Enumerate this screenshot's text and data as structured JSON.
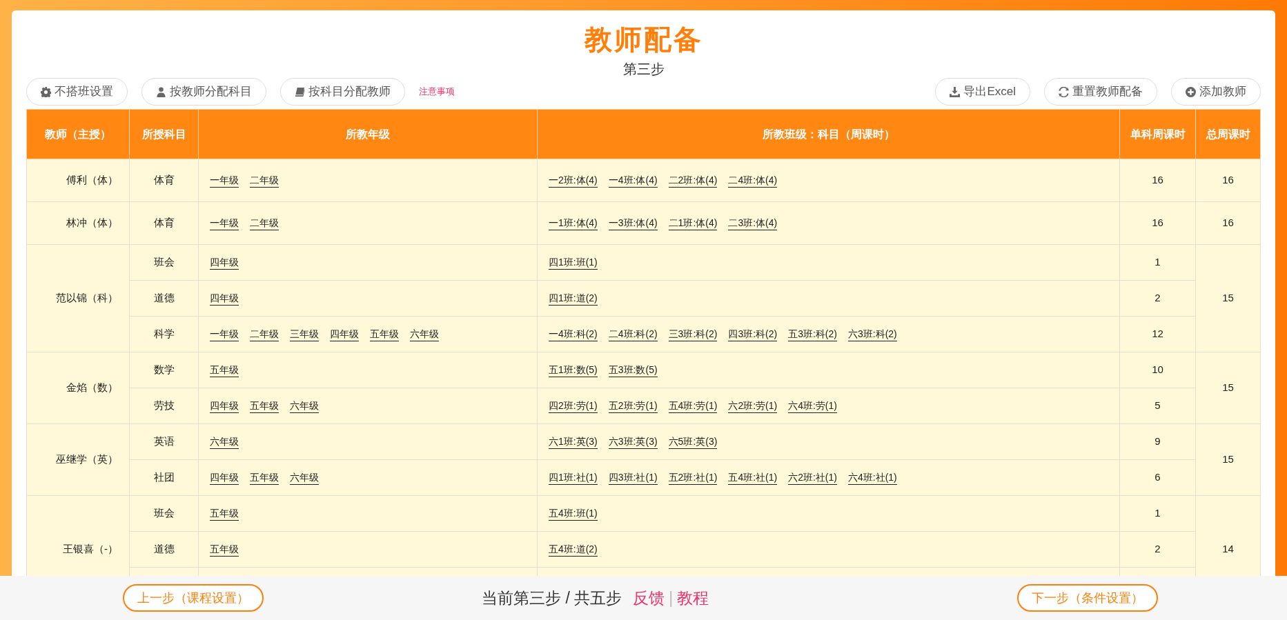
{
  "title": "教师配备",
  "step": "第三步",
  "toolbar_left": [
    "不搭班设置",
    "按教师分配科目",
    "按科目分配教师"
  ],
  "notice_link": "注意事项",
  "toolbar_right": [
    "导出Excel",
    "重置教师配备",
    "添加教师"
  ],
  "table": {
    "columns": [
      "教师（主授）",
      "所授科目",
      "所教年级",
      "所教班级：科目（周课时）",
      "单科周课时",
      "总周课时"
    ],
    "teachers": [
      {
        "name": "傅利（体）",
        "total": "16",
        "subjects": [
          {
            "subject": "体育",
            "grades": [
              "一年级",
              "二年级"
            ],
            "classes": [
              "一2班:体(4)",
              "一4班:体(4)",
              "二2班:体(4)",
              "二4班:体(4)"
            ],
            "weekly": "16"
          }
        ]
      },
      {
        "name": "林冲（体）",
        "total": "16",
        "subjects": [
          {
            "subject": "体育",
            "grades": [
              "一年级",
              "二年级"
            ],
            "classes": [
              "一1班:体(4)",
              "一3班:体(4)",
              "二1班:体(4)",
              "二3班:体(4)"
            ],
            "weekly": "16"
          }
        ]
      },
      {
        "name": "范以锦（科）",
        "total": "15",
        "subjects": [
          {
            "subject": "班会",
            "grades": [
              "四年级"
            ],
            "classes": [
              "四1班:班(1)"
            ],
            "weekly": "1"
          },
          {
            "subject": "道德",
            "grades": [
              "四年级"
            ],
            "classes": [
              "四1班:道(2)"
            ],
            "weekly": "2"
          },
          {
            "subject": "科学",
            "grades": [
              "一年级",
              "二年级",
              "三年级",
              "四年级",
              "五年级",
              "六年级"
            ],
            "classes": [
              "一4班:科(2)",
              "二4班:科(2)",
              "三3班:科(2)",
              "四3班:科(2)",
              "五3班:科(2)",
              "六3班:科(2)"
            ],
            "weekly": "12"
          }
        ]
      },
      {
        "name": "金焰（数）",
        "total": "15",
        "subjects": [
          {
            "subject": "数学",
            "grades": [
              "五年级"
            ],
            "classes": [
              "五1班:数(5)",
              "五3班:数(5)"
            ],
            "weekly": "10"
          },
          {
            "subject": "劳技",
            "grades": [
              "四年级",
              "五年级",
              "六年级"
            ],
            "classes": [
              "四2班:劳(1)",
              "五2班:劳(1)",
              "五4班:劳(1)",
              "六2班:劳(1)",
              "六4班:劳(1)"
            ],
            "weekly": "5"
          }
        ]
      },
      {
        "name": "巫继学（英）",
        "total": "15",
        "subjects": [
          {
            "subject": "英语",
            "grades": [
              "六年级"
            ],
            "classes": [
              "六1班:英(3)",
              "六3班:英(3)",
              "六5班:英(3)"
            ],
            "weekly": "9"
          },
          {
            "subject": "社团",
            "grades": [
              "四年级",
              "五年级",
              "六年级"
            ],
            "classes": [
              "四1班:社(1)",
              "四3班:社(1)",
              "五2班:社(1)",
              "五4班:社(1)",
              "六2班:社(1)",
              "六4班:社(1)"
            ],
            "weekly": "6"
          }
        ]
      },
      {
        "name": "王银喜（-）",
        "total": "14",
        "subjects": [
          {
            "subject": "班会",
            "grades": [
              "五年级"
            ],
            "classes": [
              "五4班:班(1)"
            ],
            "weekly": "1"
          },
          {
            "subject": "道德",
            "grades": [
              "五年级"
            ],
            "classes": [
              "五4班:道(2)"
            ],
            "weekly": "2"
          }
        ]
      }
    ]
  },
  "footer": {
    "prev": "上一步（课程设置）",
    "progress": "当前第三步 / 共五步",
    "links": [
      "反馈",
      "教程"
    ],
    "separator": "|",
    "next": "下一步（条件设置）"
  }
}
